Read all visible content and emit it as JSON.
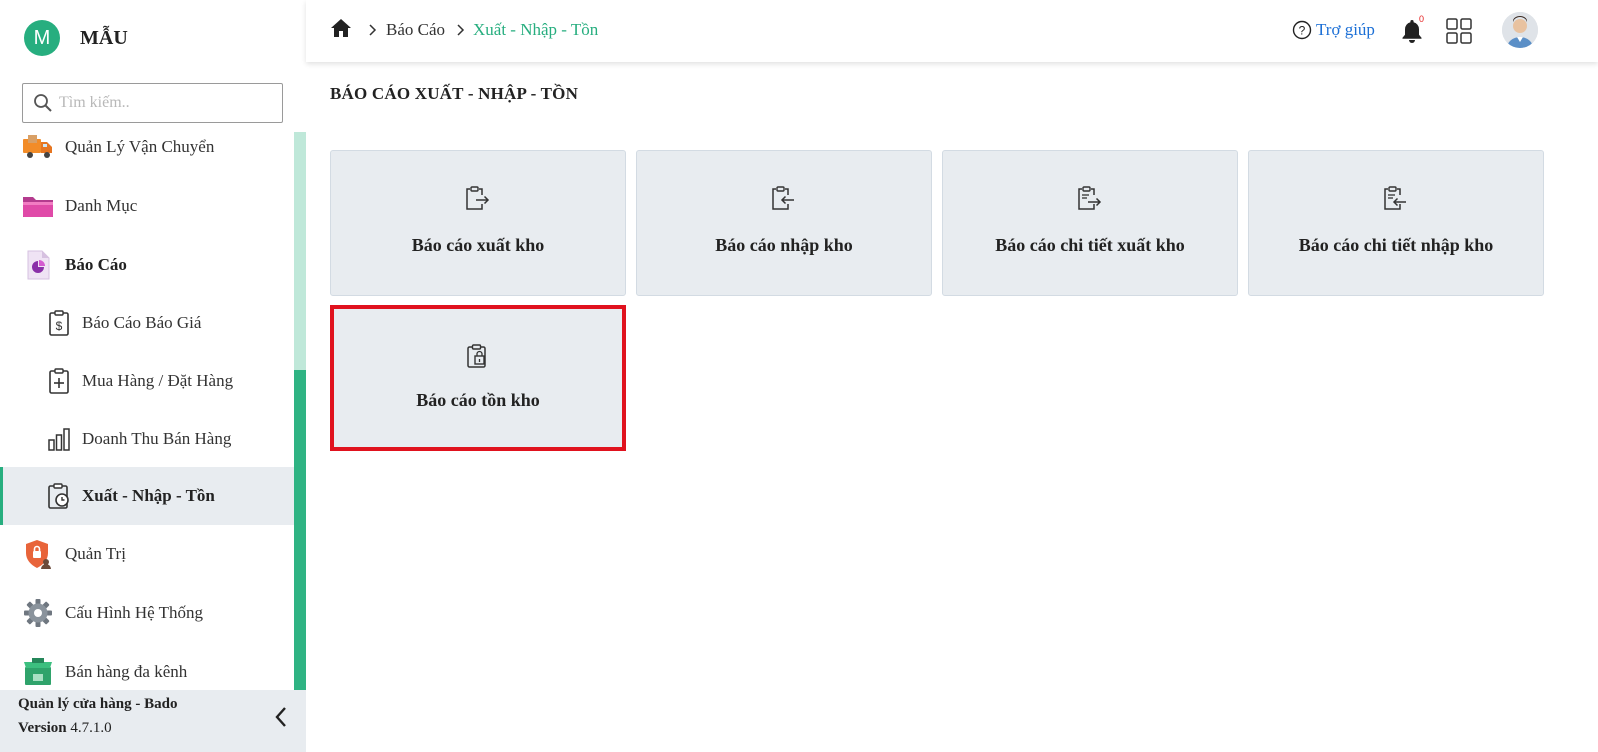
{
  "brand": {
    "initial": "M",
    "name": "MẪU"
  },
  "search": {
    "placeholder": "Tìm kiếm.."
  },
  "sidebar": {
    "items": [
      {
        "label": "Quản Lý Vận Chuyển",
        "icon": "truck-icon"
      },
      {
        "label": "Danh Mục",
        "icon": "folder-icon"
      },
      {
        "label": "Báo Cáo",
        "icon": "report-document-icon"
      },
      {
        "label": "Báo Cáo Báo Giá",
        "icon": "clipboard-dollar-icon"
      },
      {
        "label": "Mua Hàng / Đặt Hàng",
        "icon": "clipboard-plus-icon"
      },
      {
        "label": "Doanh Thu Bán Hàng",
        "icon": "bar-chart-icon"
      },
      {
        "label": "Xuất - Nhập - Tồn",
        "icon": "clipboard-clock-icon"
      },
      {
        "label": "Quản Trị",
        "icon": "admin-shield-icon"
      },
      {
        "label": "Cấu Hình Hệ Thống",
        "icon": "gear-icon"
      },
      {
        "label": "Bán hàng đa kênh",
        "icon": "multichannel-store-icon"
      }
    ],
    "active": "Xuất - Nhập - Tồn"
  },
  "footer": {
    "app_name": "Quản lý cửa hàng - Bado",
    "version_label": "Version",
    "version": "4.7.1.0"
  },
  "breadcrumb": {
    "items": [
      "Báo Cáo",
      "Xuất - Nhập - Tồn"
    ]
  },
  "header": {
    "help_label": "Trợ giúp",
    "notification_count": "0"
  },
  "page": {
    "title": "BÁO CÁO XUẤT - NHẬP - TỒN"
  },
  "cards": [
    {
      "label": "Báo cáo xuất kho",
      "icon": "clipboard-export-icon"
    },
    {
      "label": "Báo cáo nhập kho",
      "icon": "clipboard-import-icon"
    },
    {
      "label": "Báo cáo chi tiết xuất kho",
      "icon": "clipboard-list-export-icon"
    },
    {
      "label": "Báo cáo chi tiết nhập kho",
      "icon": "clipboard-list-import-icon"
    },
    {
      "label": "Báo cáo tồn kho",
      "icon": "clipboard-stock-icon"
    }
  ],
  "colors": {
    "accent": "#27ae7f",
    "link": "#1b6fd6",
    "highlight": "#e0121e",
    "card_bg": "#e8ecf0"
  }
}
